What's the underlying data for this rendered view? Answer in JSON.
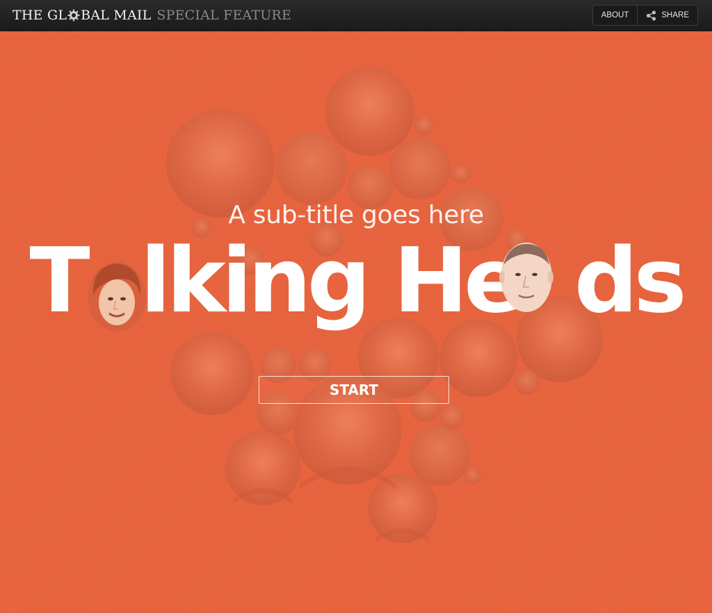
{
  "header": {
    "brand": "THE GL BAL MAIL",
    "brand_part1": "THE GL",
    "brand_part2": "BAL MAIL",
    "special": "SPECIAL FEATURE",
    "nav": {
      "about": "ABOUT",
      "share": "SHARE"
    },
    "icons": [
      "gear-logo-icon",
      "share-icon"
    ]
  },
  "hero": {
    "subtitle": "A sub-title goes here",
    "title_part1": "T",
    "title_part2": "lking He",
    "title_part3": "ds",
    "start_label": "START",
    "background_color": "#e9653f"
  }
}
